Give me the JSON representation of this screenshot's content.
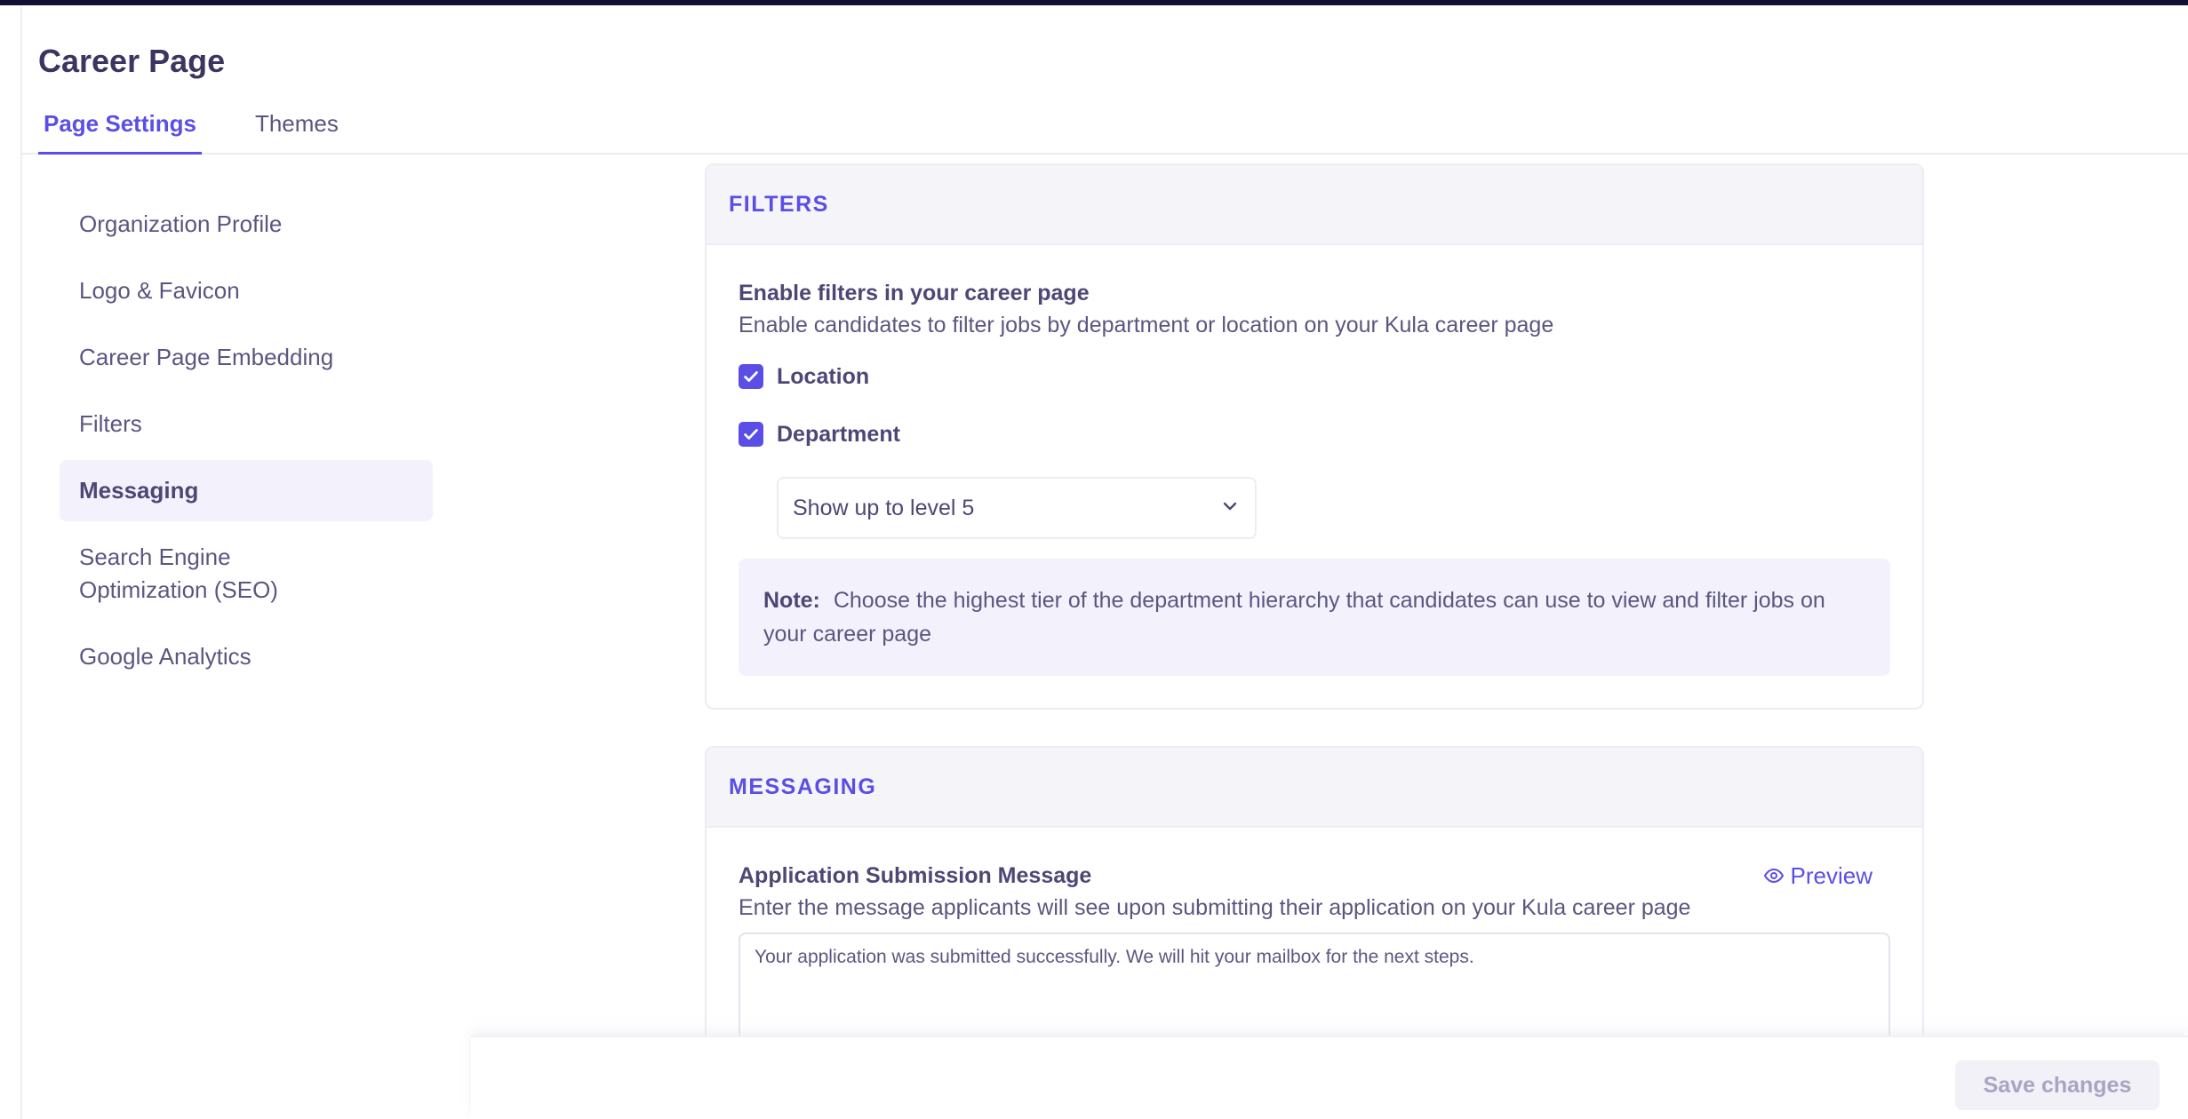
{
  "header": {
    "title": "Career Page",
    "tabs": [
      {
        "label": "Page Settings",
        "active": true
      },
      {
        "label": "Themes",
        "active": false
      }
    ]
  },
  "sidebar": {
    "items": [
      {
        "label": "Organization Profile"
      },
      {
        "label": "Logo & Favicon"
      },
      {
        "label": "Career Page Embedding"
      },
      {
        "label": "Filters"
      },
      {
        "label": "Messaging",
        "active": true
      },
      {
        "label": "Search Engine Optimization (SEO)"
      },
      {
        "label": "Google Analytics"
      }
    ]
  },
  "filters": {
    "section_title": "FILTERS",
    "field_title": "Enable filters in your career page",
    "field_desc": "Enable candidates to filter jobs by department or location on your Kula career page",
    "options": [
      {
        "label": "Location",
        "checked": true
      },
      {
        "label": "Department",
        "checked": true
      }
    ],
    "level_select": {
      "value": "Show up to level 5"
    },
    "note": {
      "label": "Note:",
      "text": "Choose the highest tier of the department hierarchy that candidates can use to view and filter jobs on your career page"
    }
  },
  "messaging": {
    "section_title": "MESSAGING",
    "field_title": "Application Submission Message",
    "preview_label": "Preview",
    "field_desc": "Enter the message applicants will see upon submitting their application on your Kula career page",
    "message_value": "Your application was submitted successfully. We will hit your mailbox for the next steps."
  },
  "footer": {
    "save_label": "Save changes"
  },
  "colors": {
    "accent": "#5b4ee6",
    "text_dark": "#3b3561",
    "text_muted": "#5b5680",
    "panel_bg": "#f4f4f9"
  }
}
